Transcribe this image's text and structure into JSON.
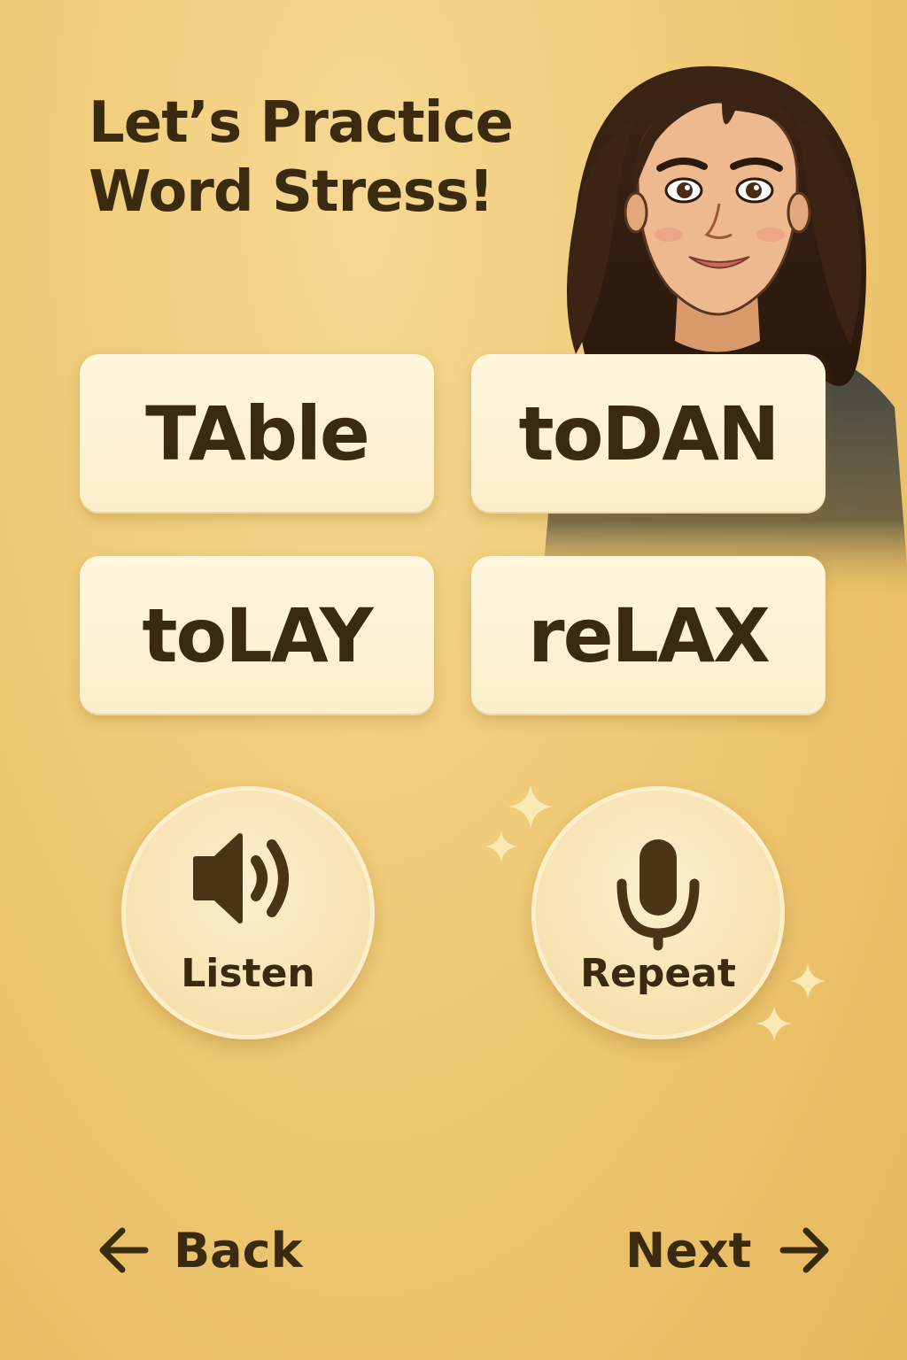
{
  "title": {
    "line1": "Let’s Practice",
    "line2": "Word Stress!"
  },
  "words": [
    "TAble",
    "toDAN",
    "toLAY",
    "reLAX"
  ],
  "actions": {
    "listen_label": "Listen",
    "listen_icon": "speaker-icon",
    "repeat_label": "Repeat",
    "repeat_icon": "microphone-icon"
  },
  "navigation": {
    "back_label": "Back",
    "back_icon": "arrow-left-icon",
    "next_label": "Next",
    "next_icon": "arrow-right-icon"
  },
  "colors": {
    "background": "#efcb78",
    "card": "#fbeecb",
    "text": "#3a2a10"
  }
}
